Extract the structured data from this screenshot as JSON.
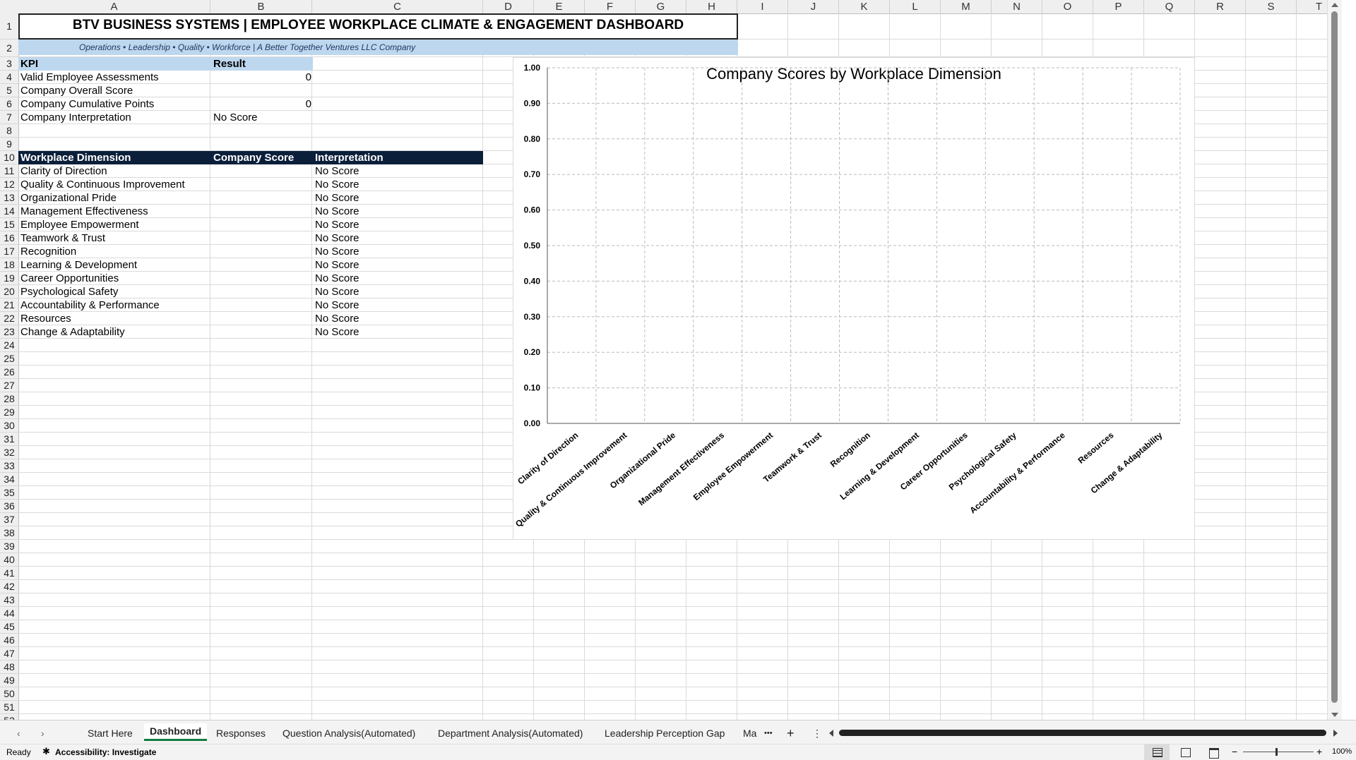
{
  "sheet": {
    "columns": [
      "A",
      "B",
      "C",
      "D",
      "E",
      "F",
      "G",
      "H",
      "I",
      "J",
      "K",
      "L",
      "M",
      "N",
      "O",
      "P",
      "Q",
      "R",
      "S",
      "T"
    ],
    "rows": [
      1,
      2,
      3,
      4,
      5,
      6,
      7,
      8,
      9,
      10,
      11,
      12,
      13,
      14,
      15,
      16,
      17,
      18,
      19,
      20,
      21,
      22,
      23,
      24,
      25,
      26,
      27,
      28,
      29,
      30,
      31,
      32,
      33,
      34,
      35,
      36,
      37,
      38,
      39,
      40,
      41,
      42,
      43,
      44,
      45,
      46,
      47,
      48,
      49,
      50,
      51,
      52
    ]
  },
  "dashboard": {
    "title": "BTV BUSINESS SYSTEMS | EMPLOYEE WORKPLACE CLIMATE & ENGAGEMENT DASHBOARD",
    "subtitle": "Operations • Leadership • Quality • Workforce | A Better Together Ventures LLC Company",
    "kpi_header": {
      "kpi": "KPI",
      "result": "Result"
    },
    "kpis": [
      {
        "label": "Valid Employee Assessments",
        "value": "0"
      },
      {
        "label": "Company Overall Score",
        "value": ""
      },
      {
        "label": "Company Cumulative Points",
        "value": "0"
      },
      {
        "label": "Company Interpretation",
        "value": "No Score"
      }
    ],
    "dimension_header": {
      "dimension": "Workplace Dimension",
      "score": "Company Score",
      "interpretation": "Interpretation"
    },
    "dimensions": [
      {
        "name": "Clarity of Direction",
        "score": "",
        "interpretation": "No Score"
      },
      {
        "name": "Quality & Continuous Improvement",
        "score": "",
        "interpretation": "No Score"
      },
      {
        "name": "Organizational Pride",
        "score": "",
        "interpretation": "No Score"
      },
      {
        "name": "Management Effectiveness",
        "score": "",
        "interpretation": "No Score"
      },
      {
        "name": "Employee Empowerment",
        "score": "",
        "interpretation": "No Score"
      },
      {
        "name": "Teamwork & Trust",
        "score": "",
        "interpretation": "No Score"
      },
      {
        "name": "Recognition",
        "score": "",
        "interpretation": "No Score"
      },
      {
        "name": "Learning & Development",
        "score": "",
        "interpretation": "No Score"
      },
      {
        "name": "Career Opportunities",
        "score": "",
        "interpretation": "No Score"
      },
      {
        "name": "Psychological Safety",
        "score": "",
        "interpretation": "No Score"
      },
      {
        "name": "Accountability & Performance",
        "score": "",
        "interpretation": "No Score"
      },
      {
        "name": "Resources",
        "score": "",
        "interpretation": "No Score"
      },
      {
        "name": "Change & Adaptability",
        "score": "",
        "interpretation": "No Score"
      }
    ]
  },
  "chart_data": {
    "type": "bar",
    "title": "Company Scores by Workplace Dimension",
    "categories": [
      "Clarity of Direction",
      "Quality & Continuous Improvement",
      "Organizational Pride",
      "Management Effectiveness",
      "Employee Empowerment",
      "Teamwork & Trust",
      "Recognition",
      "Learning & Development",
      "Career Opportunities",
      "Psychological Safety",
      "Accountability & Performance",
      "Resources",
      "Change & Adaptability"
    ],
    "values": [
      null,
      null,
      null,
      null,
      null,
      null,
      null,
      null,
      null,
      null,
      null,
      null,
      null
    ],
    "yticks": [
      "0.00",
      "0.10",
      "0.20",
      "0.30",
      "0.40",
      "0.50",
      "0.60",
      "0.70",
      "0.80",
      "0.90",
      "1.00"
    ],
    "ylim": [
      0,
      1
    ],
    "grid": true,
    "xlabel": "",
    "ylabel": ""
  },
  "tabs": {
    "items": [
      "Start Here",
      "Dashboard",
      "Responses",
      "Question Analysis(Automated)",
      "Department Analysis(Automated)",
      "Leadership Perception Gap",
      "Ma"
    ],
    "active": "Dashboard",
    "more": "•••",
    "add": "+",
    "options": "⋮"
  },
  "status": {
    "ready": "Ready",
    "accessibility": "Accessibility: Investigate",
    "zoom": "100%"
  }
}
